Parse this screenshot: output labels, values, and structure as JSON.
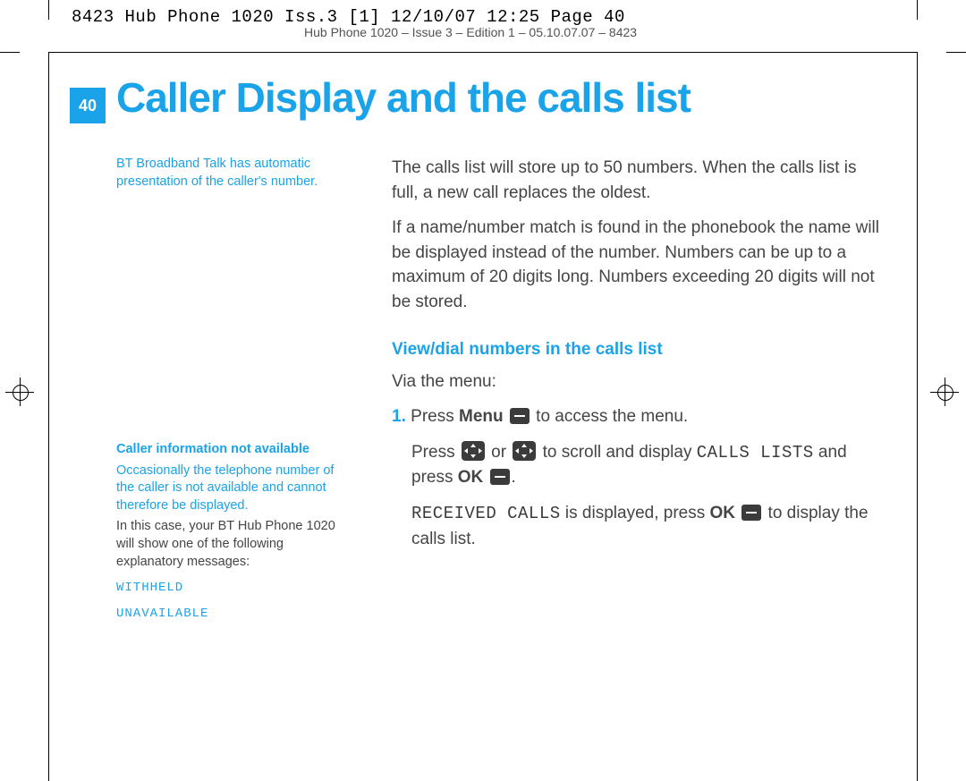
{
  "header": {
    "top": "8423 Hub Phone 1020 Iss.3 [1]  12/10/07  12:25  Page 40",
    "sub": "Hub Phone 1020 – Issue 3 – Edition 1 – 05.10.07.07 – 8423"
  },
  "page_number": "40",
  "title": "Caller Display and the calls list",
  "left": {
    "note1": "BT Broadband Talk has automatic presentation of the caller's number.",
    "note2_heading": "Caller information not available",
    "note2_body1": "Occasionally the telephone number of the caller is not available and cannot therefore be displayed.",
    "note2_body2": "In this case, your BT Hub Phone 1020 will show one of the following explanatory messages:",
    "msg1": "WITHHELD",
    "msg2": "UNAVAILABLE"
  },
  "main": {
    "p1": "The calls list will store up to 50 numbers. When the calls list is full, a new call replaces the oldest.",
    "p2": "If a name/number match is found in the phonebook the name will be displayed instead of the number. Numbers can be up to a maximum of 20 digits long. Numbers exceeding 20 digits will not be stored.",
    "sub": "View/dial numbers in the calls list",
    "via": "Via the menu:",
    "step1_num": "1.",
    "step1_a": "Press ",
    "step1_menu": "Menu",
    "step1_b": " to access the menu.",
    "step2_a": "Press ",
    "step2_b": " or ",
    "step2_c": " to scroll and display ",
    "step2_lcd": "CALLS LISTS",
    "step2_d": " and press ",
    "step2_ok": "OK",
    "step2_e": ".",
    "step3_lcd": "RECEIVED CALLS",
    "step3_a": " is displayed, press ",
    "step3_ok": "OK",
    "step3_b": " to display the calls list."
  }
}
